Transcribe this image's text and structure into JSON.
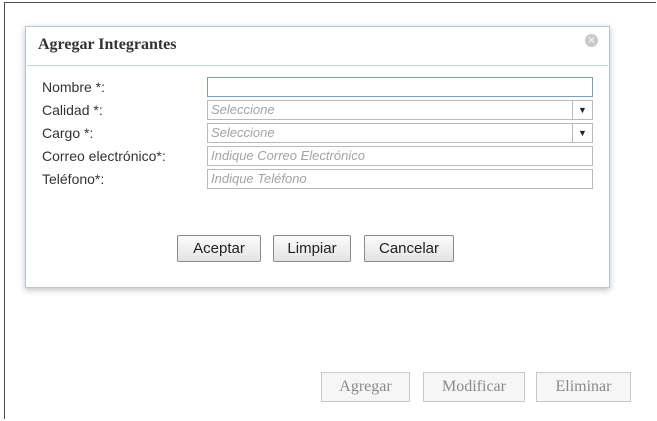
{
  "dialog": {
    "title": "Agregar Integrantes",
    "close_icon": "×",
    "fields": [
      {
        "label": "Nombre *:",
        "value": "",
        "type": "text"
      },
      {
        "label": "Calidad *:",
        "placeholder": "Seleccione",
        "type": "select"
      },
      {
        "label": "Cargo *:",
        "placeholder": "Seleccione",
        "type": "select"
      },
      {
        "label": "Correo electrónico*:",
        "placeholder": "Indique Correo Electrónico",
        "type": "text"
      },
      {
        "label": "Teléfono*:",
        "placeholder": "Indique Teléfono",
        "type": "text"
      }
    ],
    "buttons": {
      "accept": "Aceptar",
      "clear": "Limpiar",
      "cancel": "Cancelar"
    }
  },
  "bottom_buttons": {
    "add": "Agregar",
    "modify": "Modificar",
    "delete": "Eliminar"
  },
  "icons": {
    "close": "close-icon",
    "dropdown": "chevron-down-icon"
  },
  "colors": {
    "dialog_border": "#b7c7d8",
    "active_field_border": "#7f9db9",
    "placeholder": "#a3a3a3",
    "disabled_text": "#8a8a8a"
  }
}
